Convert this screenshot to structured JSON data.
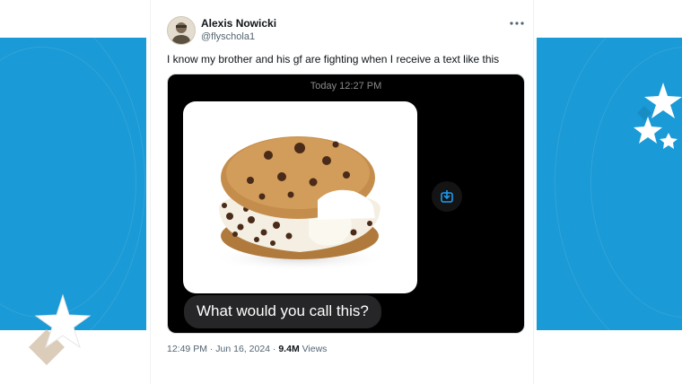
{
  "tweet": {
    "author_name": "Alexis Nowicki",
    "author_handle": "@flyschola1",
    "more_icon": "more-horizontal-icon",
    "text": "I know my brother and his gf are fighting when I receive a text like this",
    "timestamp": "12:49 PM · Jun 16, 2024",
    "separator": " · ",
    "views_count": "9.4M",
    "views_label": " Views"
  },
  "media": {
    "message_time": "Today 12:27 PM",
    "image_subject": "ice cream cookie sandwich",
    "save_icon": "download-icon",
    "message_text": "What would you call this?"
  },
  "colors": {
    "panel_blue": "#1a9ad6",
    "message_bg": "#000000",
    "bubble_bg": "#262628",
    "accent_blue": "#1d9bf0"
  }
}
